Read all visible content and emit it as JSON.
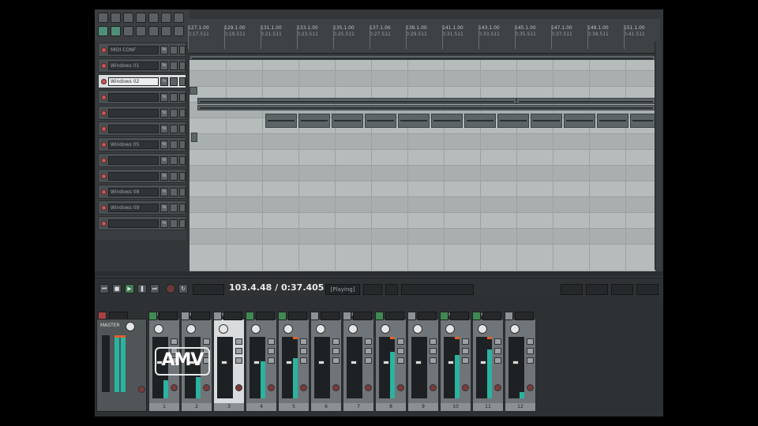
{
  "transport": {
    "time": "103.4.48 / 0:37.405",
    "state": "[Playing]"
  },
  "ruler": {
    "markers": [
      {
        "bar": "127.1.00",
        "time": "0:17.511"
      },
      {
        "bar": "129.1.00",
        "time": "0:19.511"
      },
      {
        "bar": "131.1.00",
        "time": "0:21.511"
      },
      {
        "bar": "133.1.00",
        "time": "0:23.511"
      },
      {
        "bar": "135.1.00",
        "time": "0:25.511"
      },
      {
        "bar": "137.1.00",
        "time": "0:27.511"
      },
      {
        "bar": "139.1.00",
        "time": "0:29.511"
      },
      {
        "bar": "141.1.00",
        "time": "0:31.511"
      },
      {
        "bar": "143.1.00",
        "time": "0:33.511"
      },
      {
        "bar": "145.1.00",
        "time": "0:35.511"
      },
      {
        "bar": "147.1.00",
        "time": "0:37.511"
      },
      {
        "bar": "149.1.00",
        "time": "0:39.511"
      },
      {
        "bar": "151.1.00",
        "time": "0:41.511"
      }
    ]
  },
  "tracks": [
    {
      "name": "MIDI CONF"
    },
    {
      "name": "Windows 01"
    },
    {
      "name": "Windows 02"
    },
    {
      "name": ""
    },
    {
      "name": ""
    },
    {
      "name": ""
    },
    {
      "name": "Windows 05"
    },
    {
      "name": ""
    },
    {
      "name": ""
    },
    {
      "name": "Windows 08"
    },
    {
      "name": "Windows 09"
    },
    {
      "name": ""
    }
  ],
  "mixer": {
    "master_label": "MASTER",
    "strips": [
      {
        "num": "1",
        "label": "MIDI CONF"
      },
      {
        "num": "2",
        "label": "Windows 01"
      },
      {
        "num": "3",
        "label": "Windows 02"
      },
      {
        "num": "4",
        "label": ""
      },
      {
        "num": "5",
        "label": ""
      },
      {
        "num": "6",
        "label": ""
      },
      {
        "num": "7",
        "label": "Windows 05"
      },
      {
        "num": "8",
        "label": ""
      },
      {
        "num": "9",
        "label": ""
      },
      {
        "num": "10",
        "label": "Windows 08"
      },
      {
        "num": "11",
        "label": "Windows 09"
      },
      {
        "num": "12",
        "label": ""
      }
    ],
    "levels": [
      0.3,
      0.35,
      0,
      0.6,
      0.65,
      0,
      0,
      0.75,
      0,
      0.7,
      0.8,
      0.1
    ]
  },
  "watermark": "AMV",
  "colors": {
    "accent": "#2ab3a0",
    "record": "#a84242",
    "play": "#3f7e52",
    "selected": "#d9dcde"
  }
}
